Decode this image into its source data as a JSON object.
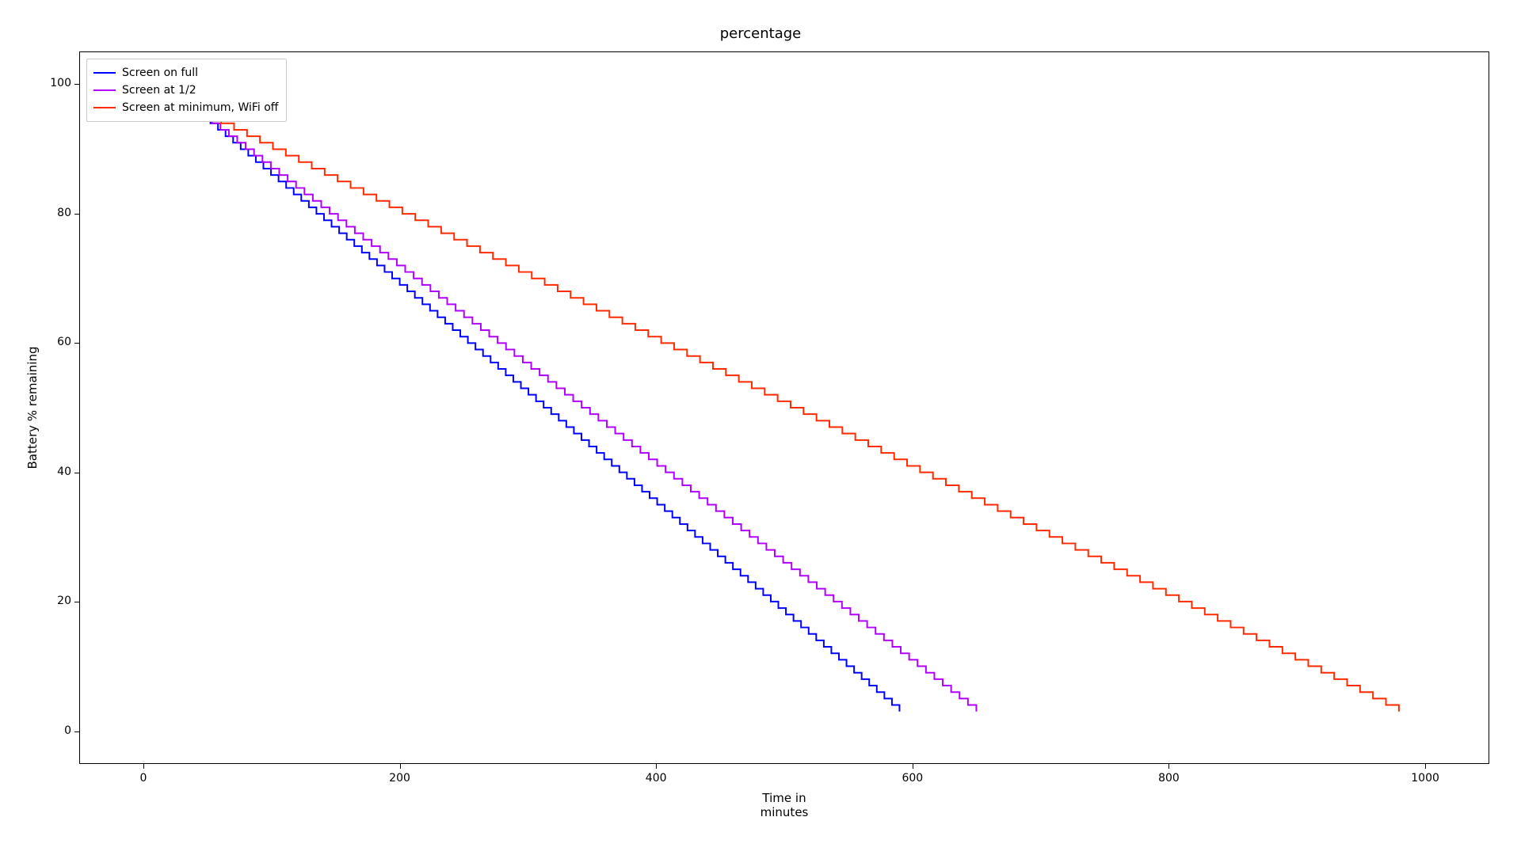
{
  "chart_data": {
    "type": "line",
    "title": "percentage",
    "xlabel": "Time in minutes",
    "ylabel": "Battery % remaining",
    "xlim": [
      -50,
      1050
    ],
    "ylim": [
      -5,
      105
    ],
    "xticks": [
      0,
      200,
      400,
      600,
      800,
      1000
    ],
    "yticks": [
      0,
      20,
      40,
      60,
      80,
      100
    ],
    "legend_position": "upper left",
    "series": [
      {
        "name": "Screen on full",
        "color": "#0000ff",
        "start_x": 40,
        "start_y": 96,
        "end_x": 590,
        "end_y": 3,
        "steps": 93
      },
      {
        "name": "Screen at 1/2",
        "color": "#b000ff",
        "start_x": 40,
        "start_y": 96,
        "end_x": 650,
        "end_y": 3,
        "steps": 93
      },
      {
        "name": "Screen at minimum, WiFi off",
        "color": "#ff2a00",
        "start_x": 40,
        "start_y": 96,
        "end_x": 980,
        "end_y": 3,
        "steps": 93
      }
    ]
  }
}
